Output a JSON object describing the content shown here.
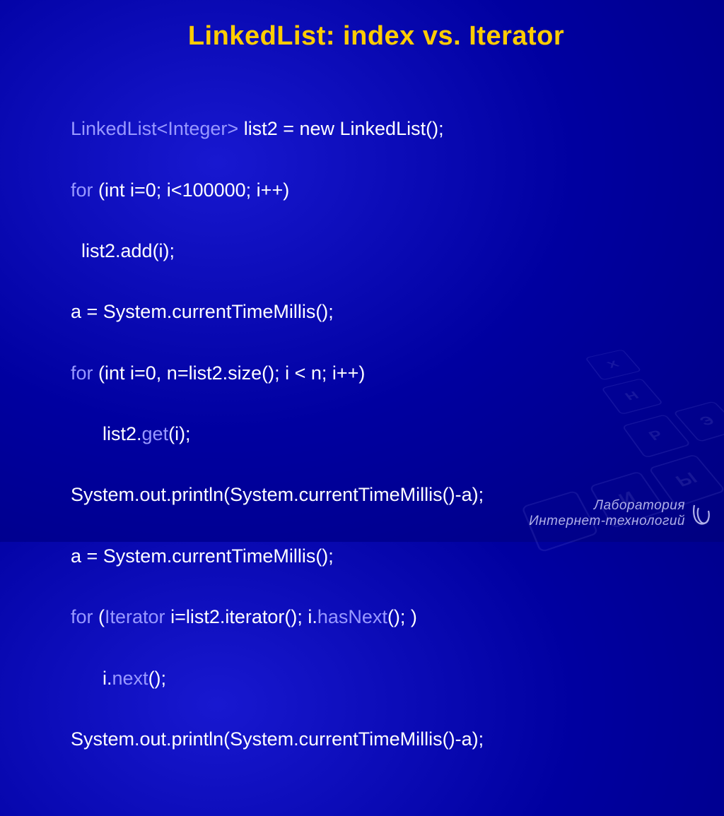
{
  "title": "LinkedList: index vs. Iterator",
  "code": {
    "line1a": "LinkedList<Integer>",
    "line1b": " list2 = new LinkedList();",
    "line2a": "for",
    "line2b": " (int i=0; i<100000; i++)",
    "line3": "  list2.add(i);",
    "line4": "a = System.currentTimeMillis();",
    "line5a": "for",
    "line5b": " (int i=0, n=list2.size(); i < n; i++)",
    "line6a": "      list2.",
    "line6b": "get",
    "line6c": "(i);",
    "line7": "System.out.println(System.currentTimeMillis()-a);",
    "line8": "a = System.currentTimeMillis();",
    "line9a": "for",
    "line9b": " (",
    "line9c": "Iterator",
    "line9d": " i=list2.iterator(); i.",
    "line9e": "hasNext",
    "line9f": "(); )",
    "line10a": "      i.",
    "line10b": "next",
    "line10c": "();",
    "line11": "System.out.println(System.currentTimeMillis()-a);"
  },
  "footer": {
    "line1": "Лаборатория",
    "line2": "Интернет-технологий"
  },
  "keys": [
    "X",
    "Н",
    "Р",
    "И",
    "Э",
    "Ы"
  ]
}
